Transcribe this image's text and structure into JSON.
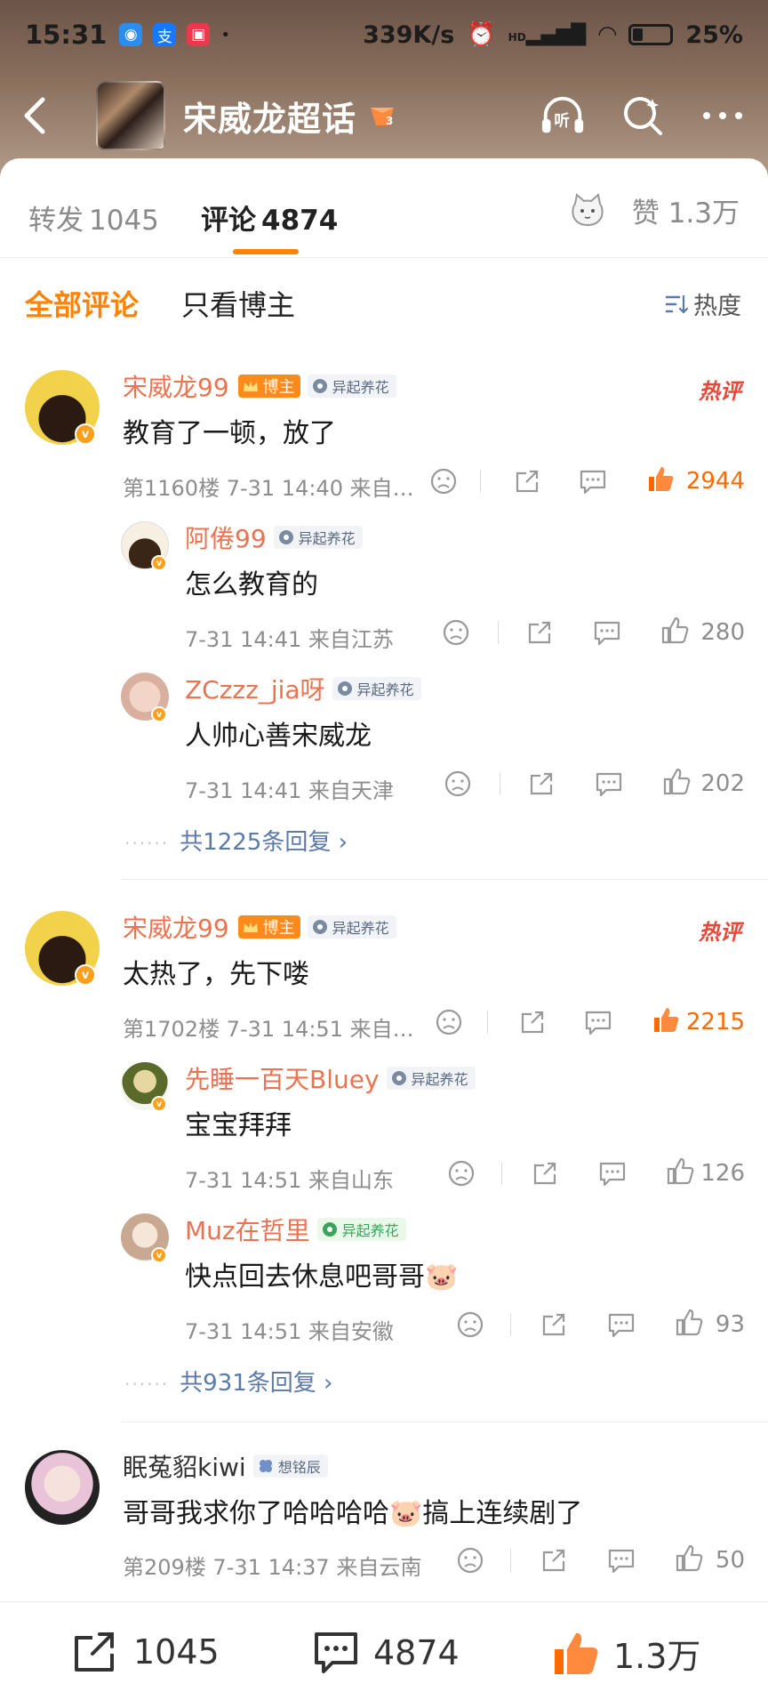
{
  "status_bar": {
    "time": "15:31",
    "speed": "339K/s",
    "battery": "25%",
    "battery_level": 0.25,
    "signal_label": "HD"
  },
  "header": {
    "title": "宋威龙超话",
    "badge_level": "3",
    "listen_label": "听"
  },
  "tabs": {
    "repost_label": "转发",
    "repost_count": "1045",
    "comment_label": "评论",
    "comment_count": "4874",
    "like_label": "赞",
    "like_count": "1.3万"
  },
  "filters": {
    "all": "全部评论",
    "author_only": "只看博主",
    "sort": "热度"
  },
  "tags": {
    "host": "博主",
    "flower": "异起养花",
    "wildflower": "想铭辰"
  },
  "hot_label": "热评",
  "comments": [
    {
      "user": "宋威龙99",
      "text": "教育了一顿，放了",
      "floor": "第1160楼 7-31 14:40 来自…",
      "likes": "2944",
      "replies": [
        {
          "user": "阿倦99",
          "text": "怎么教育的",
          "meta": "7-31 14:41  来自江苏",
          "likes": "280"
        },
        {
          "user": "ZCzzz_jia呀",
          "text": "人帅心善宋威龙",
          "meta": "7-31 14:41  来自天津",
          "likes": "202"
        }
      ],
      "more": "共1225条回复"
    },
    {
      "user": "宋威龙99",
      "text": "太热了，先下喽",
      "floor": "第1702楼 7-31 14:51 来自…",
      "likes": "2215",
      "replies": [
        {
          "user": "先睡一百天Bluey",
          "text": "宝宝拜拜",
          "meta": "7-31 14:51  来自山东",
          "likes": "126"
        },
        {
          "user": "Muz在哲里",
          "text": "快点回去休息吧哥哥🐷",
          "meta": "7-31 14:51  来自安徽",
          "likes": "93"
        }
      ],
      "more": "共931条回复"
    },
    {
      "user": "眠菟貂kiwi",
      "text": "哥哥我求你了哈哈哈哈🐷搞上连续剧了",
      "floor": "第209楼  7-31 14:37  来自云南",
      "likes": "50"
    }
  ],
  "bottom_bar": {
    "repost": "1045",
    "comment": "4874",
    "like": "1.3万"
  },
  "colors": {
    "accent": "#ff8200",
    "username": "#eb7350",
    "link": "#5b7aa8"
  },
  "icons": [
    "back-icon",
    "listen-icon",
    "search-icon",
    "more-icon",
    "cat-icon",
    "sort-icon",
    "dislike-icon",
    "share-icon",
    "comment-icon",
    "like-icon"
  ]
}
